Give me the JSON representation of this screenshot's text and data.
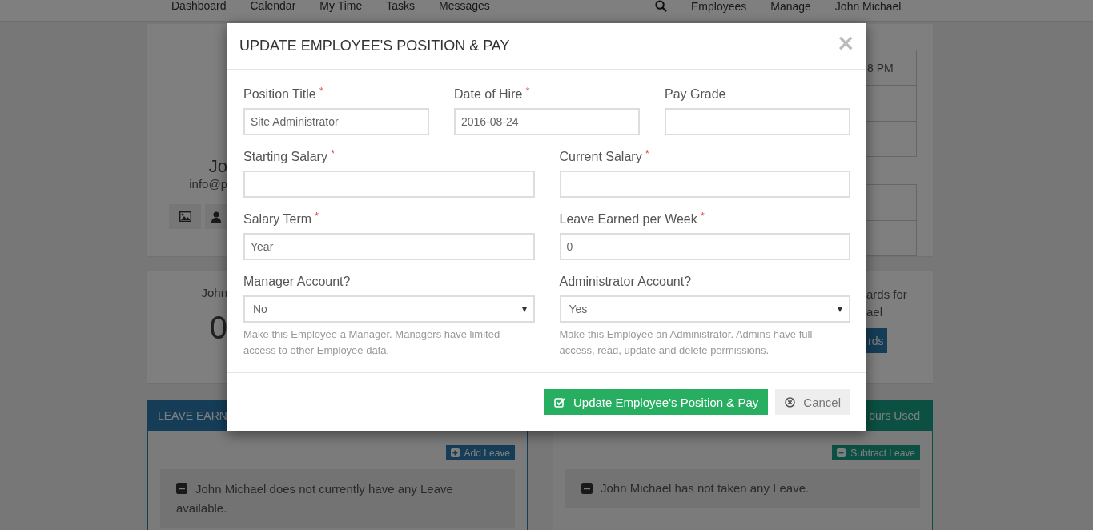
{
  "nav": {
    "items": [
      "Dashboard",
      "Calendar",
      "My Time",
      "Tasks",
      "Messages"
    ],
    "right_items": [
      "Employees",
      "Manage",
      "John Michael"
    ]
  },
  "profile": {
    "name": "Jo",
    "email": "info@p",
    "table_cell": "8 PM"
  },
  "summary": {
    "label": "John",
    "value": "0",
    "text_lines": [
      "ards for",
      "ael"
    ],
    "button": "rds"
  },
  "panels": [
    {
      "kind": "earned",
      "title": "LEAVE EARN",
      "button": "Add Leave",
      "message": "John Michael does not currently have any Leave available."
    },
    {
      "kind": "used",
      "title": "ours Used",
      "button": "Subtract Leave",
      "message": "John Michael has not taken any Leave."
    }
  ],
  "modal": {
    "title": "UPDATE EMPLOYEE'S POSITION & PAY",
    "close": "×",
    "rows": [
      [
        {
          "label": "Position Title",
          "required_mark": "*",
          "kind": "input",
          "value": "Site Administrator"
        },
        {
          "label": "Date of Hire",
          "required_mark": "*",
          "kind": "input",
          "value": "2016-08-24"
        },
        {
          "label": "Pay Grade",
          "kind": "input"
        }
      ],
      [
        {
          "label": "Starting Salary",
          "required_mark": "*",
          "kind": "input"
        },
        {
          "label": "Current Salary",
          "required_mark": "*",
          "kind": "input"
        }
      ],
      [
        {
          "label": "Salary Term",
          "required_mark": "*",
          "kind": "input",
          "value": "Year"
        },
        {
          "label": "Leave Earned per Week",
          "required_mark": "*",
          "kind": "input",
          "value": "0"
        }
      ],
      [
        {
          "label": "Manager Account?",
          "kind": "select",
          "value": "No",
          "help": "Make this Employee a Manager. Managers have limited access to other Employee data."
        },
        {
          "label": "Administrator Account?",
          "kind": "select",
          "value": "Yes",
          "help": "Make this Employee an Administrator. Admins have full access, read, update and delete permissions."
        }
      ]
    ],
    "buttons": [
      {
        "kind": "primary",
        "label": "Update Employee's Position & Pay"
      },
      {
        "kind": "cancel",
        "label": "Cancel"
      }
    ]
  }
}
